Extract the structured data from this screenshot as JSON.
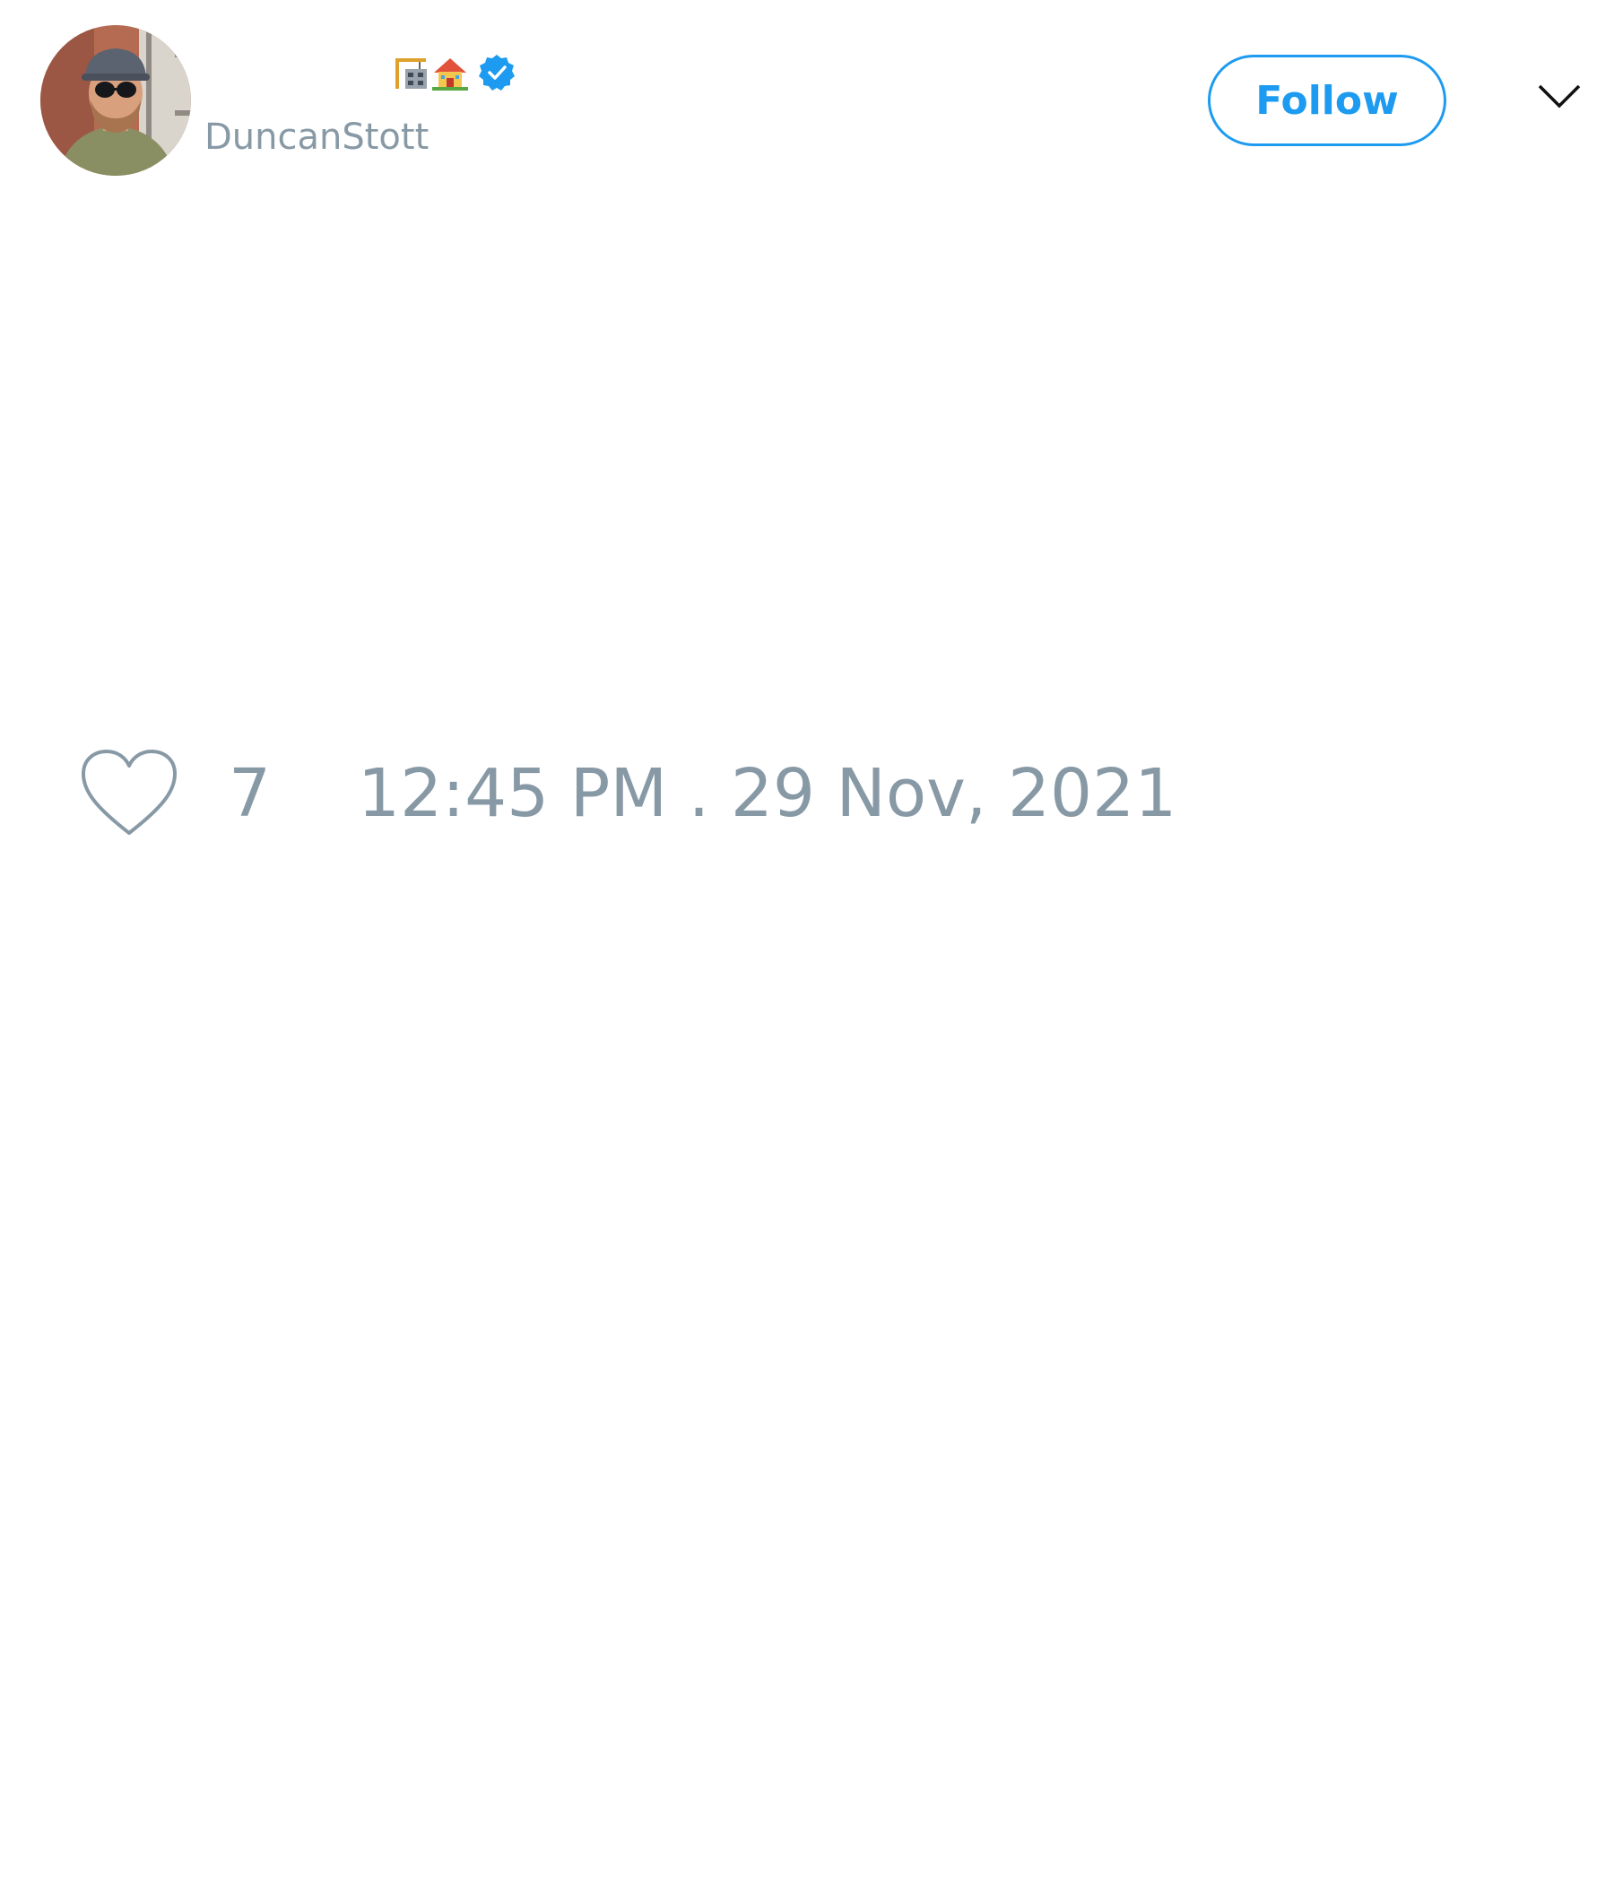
{
  "tweet": {
    "author": {
      "avatar": "avatar-photo",
      "display_name_icons": [
        "construction-emoji",
        "house-emoji"
      ],
      "verified_icon": "verified-badge-icon",
      "handle": "DuncanStott"
    },
    "follow_label": "Follow",
    "menu_icon": "chevron-down-icon",
    "like_icon": "heart-icon",
    "like_count": "7",
    "timestamp": "12:45 PM . 29 Nov, 2021"
  },
  "colors": {
    "accent": "#1d9bf0",
    "muted_text": "#8899a6",
    "background": "#ffffff"
  }
}
